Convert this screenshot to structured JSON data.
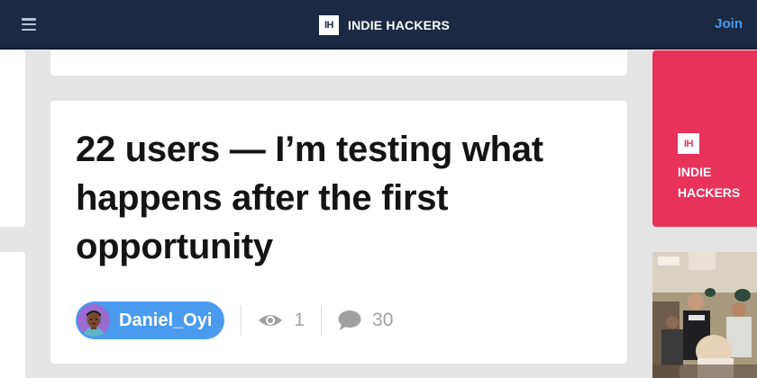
{
  "header": {
    "brand_logo": "IH",
    "brand_name": "INDIE HACKERS",
    "join_label": "Join",
    "menu_icon": "hamburger-icon"
  },
  "post": {
    "title": "22 users — I’m testing what happens after the first opportunity",
    "author": "Daniel_Oyi",
    "views": "1",
    "comments": "30"
  },
  "sidebar": {
    "promo_logo": "IH",
    "promo_text": "INDIE HACKERS"
  },
  "colors": {
    "header_bg": "#1b2942",
    "accent_blue": "#4a9bef",
    "promo_pink": "#e8325a",
    "page_bg": "#e4e4e4"
  }
}
